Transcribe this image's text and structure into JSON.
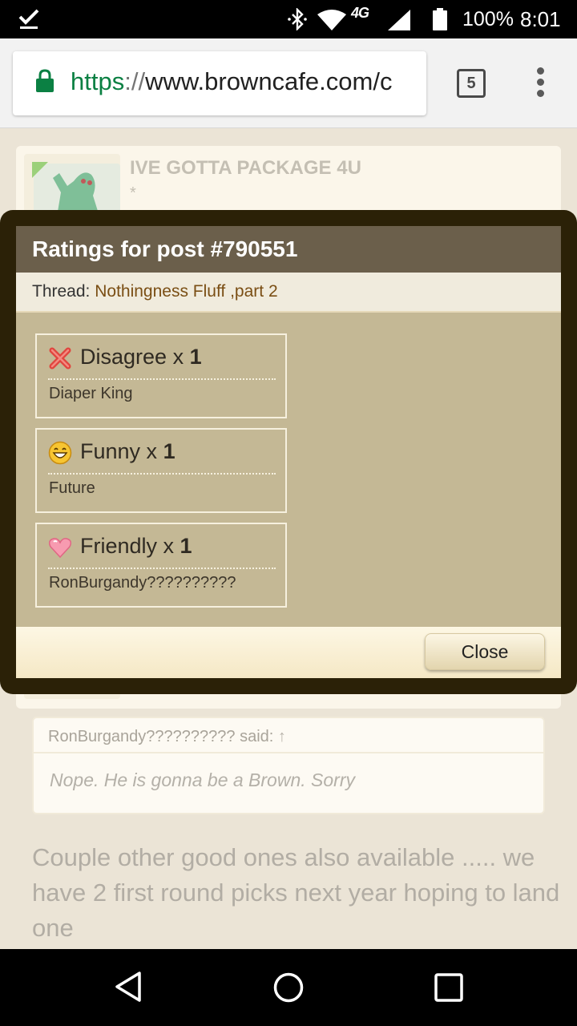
{
  "status_bar": {
    "network_label": "4G",
    "battery_pct": "100%",
    "time": "8:01"
  },
  "browser": {
    "url_scheme": "https",
    "url_separator": "://",
    "url_host": "www.browncafe.com/c",
    "tab_count": "5"
  },
  "post": {
    "username": "IVE GOTTA PACKAGE 4U",
    "user_title": "*",
    "quote_author": "RonBurgandy?????????? said:",
    "quote_arrow": "↑",
    "quote_text": "Nope. He is gonna be a Brown. Sorry",
    "body_text": "Couple other good ones also available ..... we have 2 first round picks next year hoping to land one"
  },
  "dialog": {
    "title": "Ratings for post #790551",
    "thread_prefix": "Thread: ",
    "thread_title": "Nothingness Fluff ,part 2",
    "ratings": [
      {
        "label": "Disagree",
        "times": " x ",
        "count": "1",
        "user": "Diaper King",
        "icon": "disagree-x-icon"
      },
      {
        "label": "Funny",
        "times": " x ",
        "count": "1",
        "user": "Future",
        "icon": "funny-smiley-icon"
      },
      {
        "label": "Friendly",
        "times": " x ",
        "count": "1",
        "user": "RonBurgandy??????????",
        "icon": "friendly-heart-icon"
      }
    ],
    "close_label": "Close"
  },
  "colors": {
    "dialog_title_bg": "#6b5f4b",
    "dialog_body_bg": "#c4b895",
    "thread_link": "#7a4e14",
    "url_scheme_green": "#0b8043",
    "overlay_frame": "#2b2107"
  }
}
